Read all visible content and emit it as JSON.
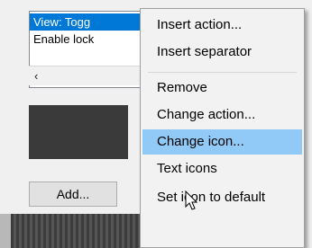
{
  "list": {
    "row1": "View: Togg",
    "row2": "Enable lock",
    "scroll_left_glyph": "‹"
  },
  "buttons": {
    "add_label": "Add..."
  },
  "context_menu": {
    "items": [
      {
        "label": "Insert action..."
      },
      {
        "label": "Insert separator"
      },
      {
        "label": "Remove"
      },
      {
        "label": "Change action..."
      },
      {
        "label": "Change icon..."
      },
      {
        "label": "Text icons"
      },
      {
        "label": "Set icon to default"
      }
    ],
    "highlighted_index": 4,
    "highlight_color": "#91c9f7"
  },
  "colors": {
    "selection": "#0078d7"
  }
}
